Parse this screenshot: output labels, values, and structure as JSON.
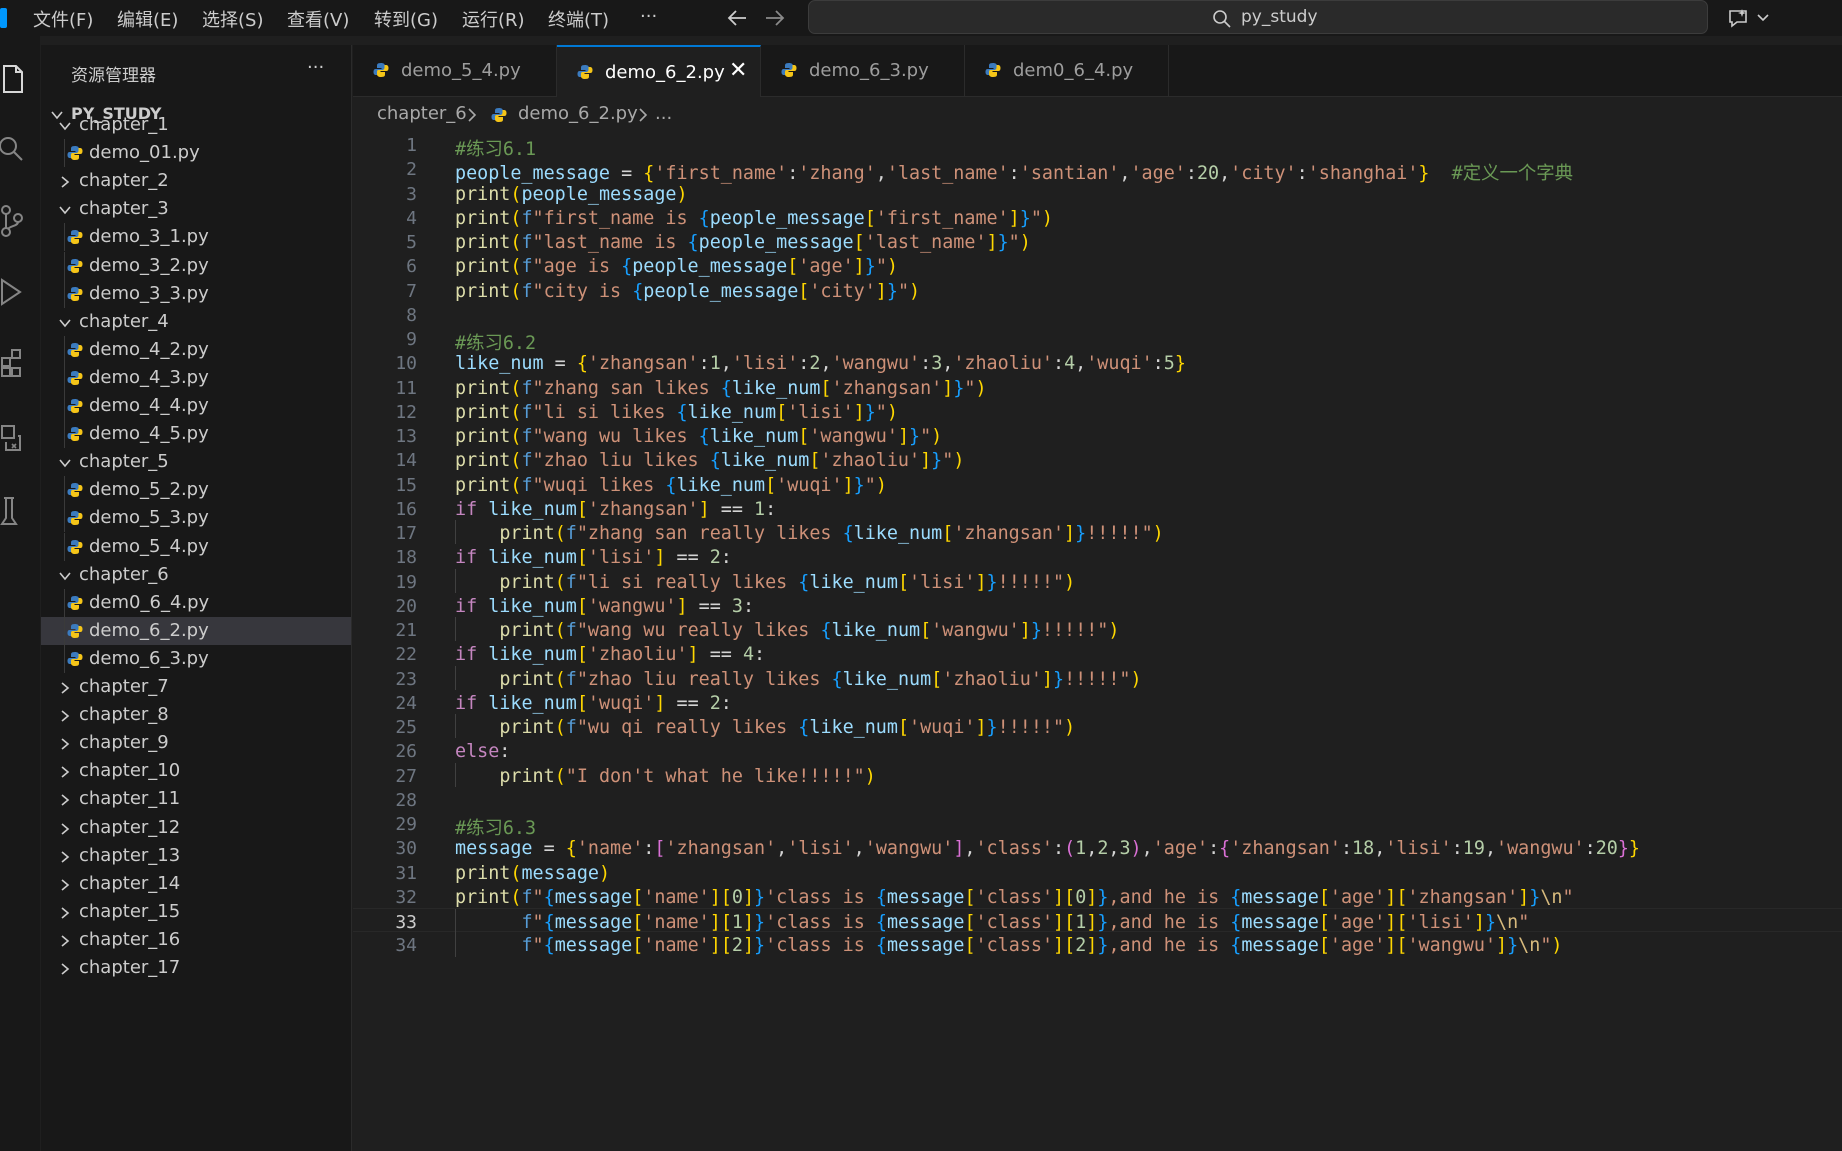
{
  "titlebar": {
    "menus": [
      "文件(F)",
      "编辑(E)",
      "选择(S)",
      "查看(V)",
      "转到(G)",
      "运行(R)",
      "终端(T)",
      "···"
    ],
    "back_icon": "arrow-left-icon",
    "forward_icon": "arrow-right-icon",
    "search_text": "py_study",
    "copilot_icon": "copilot-chat-icon"
  },
  "activity_bar": {
    "icons": [
      "explorer-icon",
      "search-icon",
      "source-control-icon",
      "run-debug-icon",
      "extensions-icon",
      "remote-explorer-icon",
      "testing-icon"
    ]
  },
  "sidebar": {
    "title": "资源管理器",
    "more": "···",
    "project": "PY_STUDY",
    "tree": [
      {
        "label": "chapter_1",
        "type": "folder",
        "open": true,
        "depth": 0
      },
      {
        "label": "demo_01.py",
        "type": "file",
        "depth": 1
      },
      {
        "label": "chapter_2",
        "type": "folder",
        "open": false,
        "depth": 0
      },
      {
        "label": "chapter_3",
        "type": "folder",
        "open": true,
        "depth": 0
      },
      {
        "label": "demo_3_1.py",
        "type": "file",
        "depth": 1
      },
      {
        "label": "demo_3_2.py",
        "type": "file",
        "depth": 1
      },
      {
        "label": "demo_3_3.py",
        "type": "file",
        "depth": 1
      },
      {
        "label": "chapter_4",
        "type": "folder",
        "open": true,
        "depth": 0
      },
      {
        "label": "demo_4_2.py",
        "type": "file",
        "depth": 1
      },
      {
        "label": "demo_4_3.py",
        "type": "file",
        "depth": 1
      },
      {
        "label": "demo_4_4.py",
        "type": "file",
        "depth": 1
      },
      {
        "label": "demo_4_5.py",
        "type": "file",
        "depth": 1
      },
      {
        "label": "chapter_5",
        "type": "folder",
        "open": true,
        "depth": 0
      },
      {
        "label": "demo_5_2.py",
        "type": "file",
        "depth": 1
      },
      {
        "label": "demo_5_3.py",
        "type": "file",
        "depth": 1
      },
      {
        "label": "demo_5_4.py",
        "type": "file",
        "depth": 1
      },
      {
        "label": "chapter_6",
        "type": "folder",
        "open": true,
        "depth": 0
      },
      {
        "label": "dem0_6_4.py",
        "type": "file",
        "depth": 1
      },
      {
        "label": "demo_6_2.py",
        "type": "file",
        "depth": 1,
        "selected": true
      },
      {
        "label": "demo_6_3.py",
        "type": "file",
        "depth": 1
      },
      {
        "label": "chapter_7",
        "type": "folder",
        "open": false,
        "depth": 0
      },
      {
        "label": "chapter_8",
        "type": "folder",
        "open": false,
        "depth": 0
      },
      {
        "label": "chapter_9",
        "type": "folder",
        "open": false,
        "depth": 0
      },
      {
        "label": "chapter_10",
        "type": "folder",
        "open": false,
        "depth": 0
      },
      {
        "label": "chapter_11",
        "type": "folder",
        "open": false,
        "depth": 0
      },
      {
        "label": "chapter_12",
        "type": "folder",
        "open": false,
        "depth": 0
      },
      {
        "label": "chapter_13",
        "type": "folder",
        "open": false,
        "depth": 0
      },
      {
        "label": "chapter_14",
        "type": "folder",
        "open": false,
        "depth": 0
      },
      {
        "label": "chapter_15",
        "type": "folder",
        "open": false,
        "depth": 0
      },
      {
        "label": "chapter_16",
        "type": "folder",
        "open": false,
        "depth": 0
      },
      {
        "label": "chapter_17",
        "type": "folder",
        "open": false,
        "depth": 0
      }
    ]
  },
  "tabs": [
    {
      "label": "demo_5_4.py",
      "active": false
    },
    {
      "label": "demo_6_2.py",
      "active": true,
      "close": "✕"
    },
    {
      "label": "demo_6_3.py",
      "active": false
    },
    {
      "label": "dem0_6_4.py",
      "active": false
    }
  ],
  "breadcrumb": {
    "folder": "chapter_6",
    "file": "demo_6_2.py",
    "more": "..."
  },
  "editor": {
    "current_line": 33,
    "lines": [
      "#练习6.1",
      "people_message = {'first_name':'zhang','last_name':'santian','age':20,'city':'shanghai'}  #定义一个字典",
      "print(people_message)",
      "print(f\"first_name is {people_message['first_name']}\")",
      "print(f\"last_name is {people_message['last_name']}\")",
      "print(f\"age is {people_message['age']}\")",
      "print(f\"city is {people_message['city']}\")",
      "",
      "#练习6.2",
      "like_num = {'zhangsan':1,'lisi':2,'wangwu':3,'zhaoliu':4,'wuqi':5}",
      "print(f\"zhang san likes {like_num['zhangsan']}\")",
      "print(f\"li si likes {like_num['lisi']}\")",
      "print(f\"wang wu likes {like_num['wangwu']}\")",
      "print(f\"zhao liu likes {like_num['zhaoliu']}\")",
      "print(f\"wuqi likes {like_num['wuqi']}\")",
      "if like_num['zhangsan'] == 1:",
      "    print(f\"zhang san really likes {like_num['zhangsan']}!!!!!\")",
      "if like_num['lisi'] == 2:",
      "    print(f\"li si really likes {like_num['lisi']}!!!!!\")",
      "if like_num['wangwu'] == 3:",
      "    print(f\"wang wu really likes {like_num['wangwu']}!!!!!\")",
      "if like_num['zhaoliu'] == 4:",
      "    print(f\"zhao liu really likes {like_num['zhaoliu']}!!!!!\")",
      "if like_num['wuqi'] == 2:",
      "    print(f\"wu qi really likes {like_num['wuqi']}!!!!!\")",
      "else:",
      "    print(\"I don't what he like!!!!!\")",
      "",
      "#练习6.3",
      "message = {'name':['zhangsan','lisi','wangwu'],'class':(1,2,3),'age':{'zhangsan':18,'lisi':19,'wangwu':20}}",
      "print(message)",
      "print(f\"{message['name'][0]}'class is {message['class'][0]},and he is {message['age']['zhangsan']}\\n\"",
      "      f\"{message['name'][1]}'class is {message['class'][1]},and he is {message['age']['lisi']}\\n\"",
      "      f\"{message['name'][2]}'class is {message['class'][2]},and he is {message['age']['wangwu']}\\n\")"
    ]
  },
  "colors": {
    "keyword": "#c586c0",
    "function": "#dcdcaa",
    "variable": "#9cdcfe",
    "string": "#ce9178",
    "number": "#b5cea8",
    "comment": "#6a9955",
    "python_icon_blue": "#3b7bbf",
    "python_icon_yellow": "#f5c518",
    "accent": "#0078d4"
  }
}
